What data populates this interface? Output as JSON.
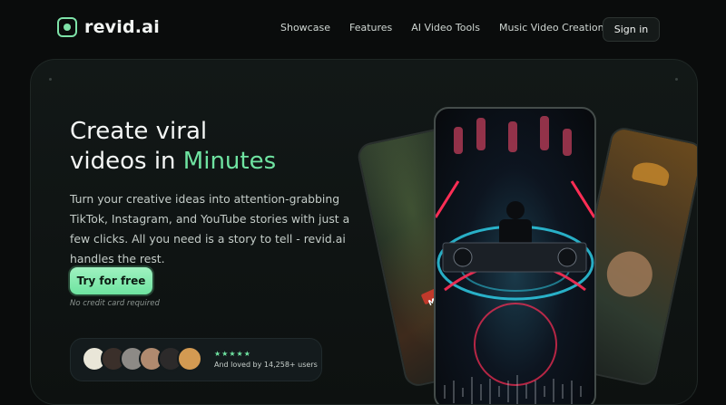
{
  "brand": {
    "name": "revid.ai",
    "accent": "#6fe3a1"
  },
  "nav": {
    "links": [
      "Showcase",
      "Features",
      "AI Video Tools",
      "Music Video Creation"
    ],
    "signin_label": "Sign in"
  },
  "hero": {
    "headline_line1": "Create viral",
    "headline_line2_prefix": "videos in ",
    "headline_accent": "Minutes",
    "description": "Turn your creative ideas into attention-grabbing TikTok, Instagram, and YouTube stories with just a few clicks. All you need is a story to tell - revid.ai handles the rest.",
    "cta_label": "Try for free",
    "cta_note": "No credit card required",
    "social": {
      "stars": "★★★★★",
      "text": "And loved by 14,258+ users"
    },
    "tag_text": "Ma"
  }
}
